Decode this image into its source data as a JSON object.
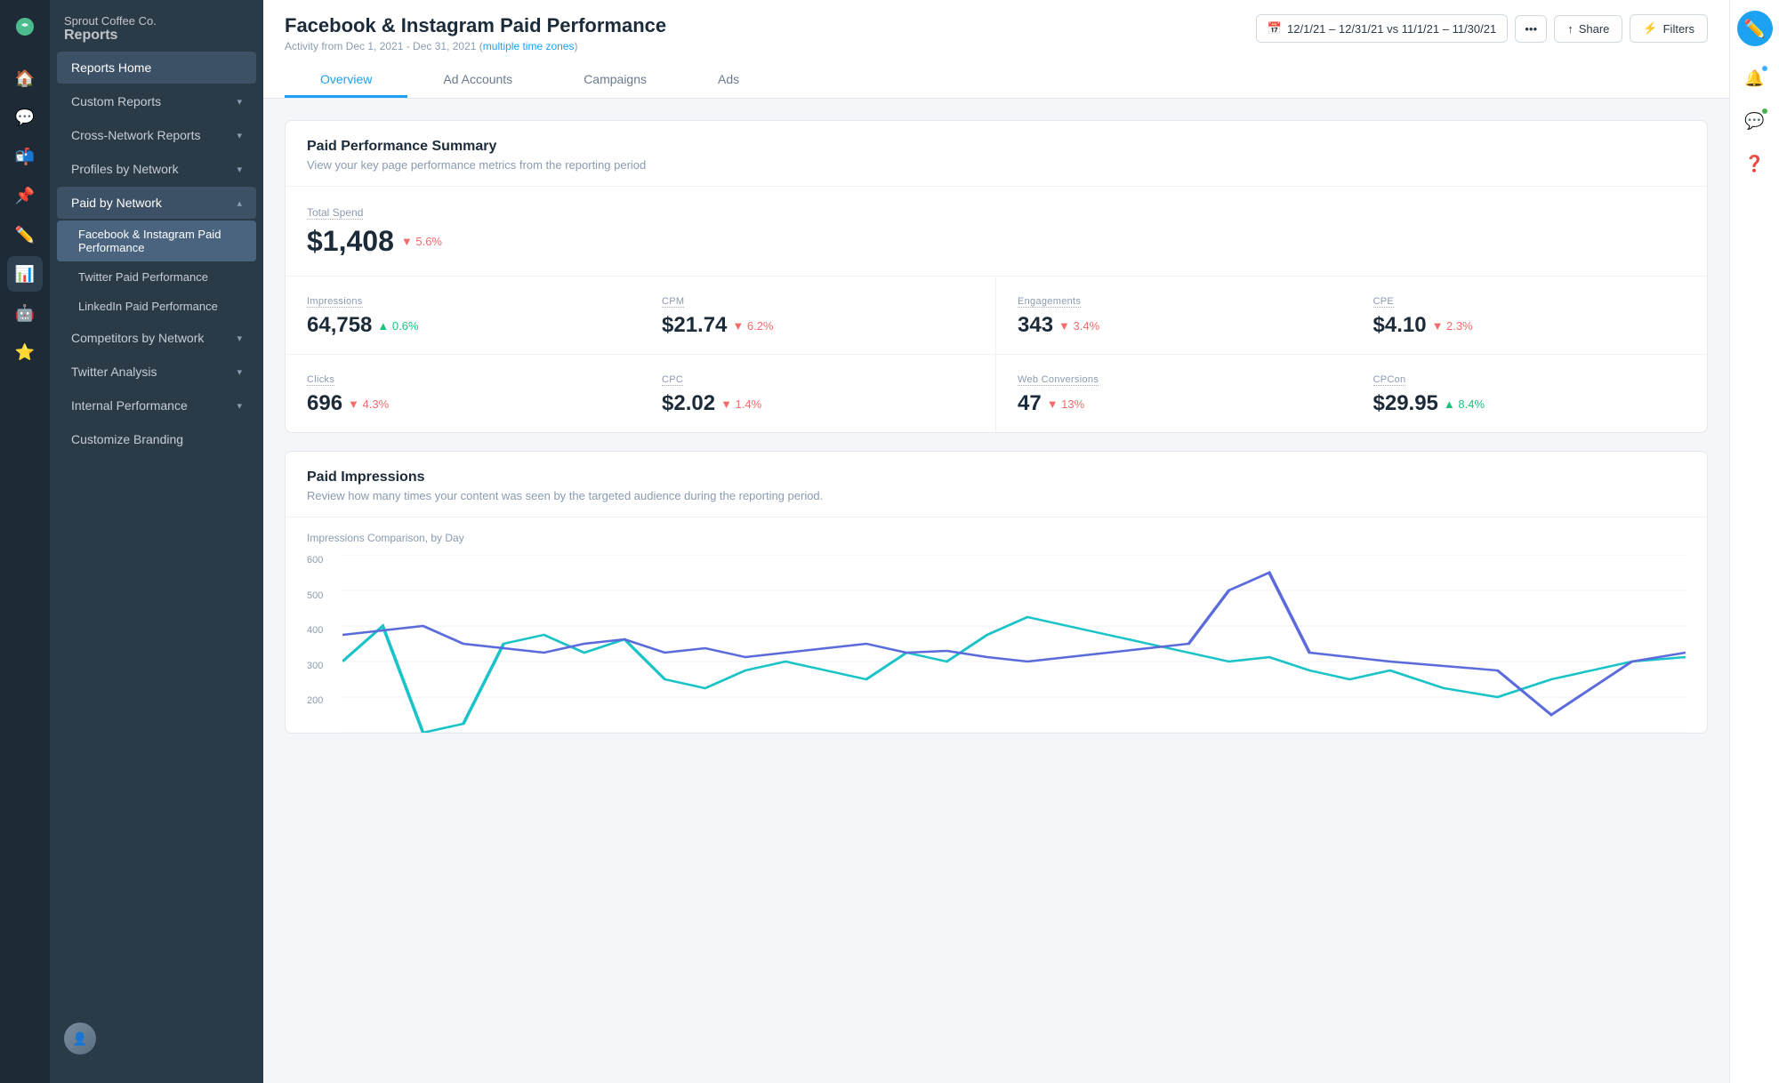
{
  "brand": {
    "company": "Sprout Coffee Co.",
    "app": "Reports"
  },
  "sidebar": {
    "items": [
      {
        "id": "reports-home",
        "label": "Reports Home",
        "active": true,
        "hasChevron": false
      },
      {
        "id": "custom-reports",
        "label": "Custom Reports",
        "active": false,
        "hasChevron": true
      },
      {
        "id": "cross-network",
        "label": "Cross-Network Reports",
        "active": false,
        "hasChevron": true
      },
      {
        "id": "profiles-by-network",
        "label": "Profiles by Network",
        "active": false,
        "hasChevron": true
      },
      {
        "id": "paid-by-network",
        "label": "Paid by Network",
        "active": false,
        "hasChevron": true
      }
    ],
    "sub_items": [
      {
        "id": "fb-ig-paid",
        "label": "Facebook & Instagram Paid Performance",
        "active": true
      },
      {
        "id": "twitter-paid",
        "label": "Twitter Paid Performance",
        "active": false
      },
      {
        "id": "linkedin-paid",
        "label": "LinkedIn Paid Performance",
        "active": false
      }
    ],
    "bottom_items": [
      {
        "id": "competitors",
        "label": "Competitors by Network",
        "hasChevron": true
      },
      {
        "id": "twitter-analysis",
        "label": "Twitter Analysis",
        "hasChevron": true
      },
      {
        "id": "internal-performance",
        "label": "Internal Performance",
        "hasChevron": true
      },
      {
        "id": "customize-branding",
        "label": "Customize Branding",
        "hasChevron": false
      }
    ]
  },
  "header": {
    "title": "Facebook & Instagram Paid Performance",
    "subtitle": "Activity from Dec 1, 2021 - Dec 31, 2021",
    "timezone_label": "multiple time zones",
    "date_range": "12/1/21 – 12/31/21",
    "compare_range": "vs 11/1/21 – 11/30/21",
    "share_label": "Share",
    "filters_label": "Filters"
  },
  "tabs": [
    {
      "id": "overview",
      "label": "Overview",
      "active": true
    },
    {
      "id": "ad-accounts",
      "label": "Ad Accounts",
      "active": false
    },
    {
      "id": "campaigns",
      "label": "Campaigns",
      "active": false
    },
    {
      "id": "ads",
      "label": "Ads",
      "active": false
    }
  ],
  "summary": {
    "title": "Paid Performance Summary",
    "subtitle": "View your key page performance metrics from the reporting period",
    "total_spend_label": "Total Spend",
    "total_spend_value": "$1,408",
    "total_spend_change": "▼ 5.6%",
    "total_spend_direction": "down",
    "metrics_left": [
      {
        "label": "Impressions",
        "value": "64,758",
        "change": "▲ 0.6%",
        "direction": "up"
      },
      {
        "label": "CPM",
        "value": "$21.74",
        "change": "▼ 6.2%",
        "direction": "down"
      },
      {
        "label": "Clicks",
        "value": "696",
        "change": "▼ 4.3%",
        "direction": "down"
      },
      {
        "label": "CPC",
        "value": "$2.02",
        "change": "▼ 1.4%",
        "direction": "down"
      }
    ],
    "metrics_right": [
      {
        "label": "Engagements",
        "value": "343",
        "change": "▼ 3.4%",
        "direction": "down"
      },
      {
        "label": "CPE",
        "value": "$4.10",
        "change": "▼ 2.3%",
        "direction": "down"
      },
      {
        "label": "Web Conversions",
        "value": "47",
        "change": "▼ 13%",
        "direction": "down"
      },
      {
        "label": "CPCon",
        "value": "$29.95",
        "change": "▲ 8.4%",
        "direction": "up"
      }
    ]
  },
  "impressions_chart": {
    "title": "Paid Impressions",
    "subtitle": "Review how many times your content was seen by the targeted audience during the reporting period.",
    "comparison_label": "Impressions Comparison, by Day",
    "y_labels": [
      "600",
      "500",
      "400",
      "300",
      "200"
    ],
    "colors": {
      "current": "#19c3c8",
      "previous": "#5b6bdb"
    }
  },
  "icons": {
    "calendar": "📅",
    "share": "↑",
    "filter": "⚡",
    "chevron_down": "▾",
    "chevron_up": "▴",
    "arrow_up": "▲",
    "arrow_down": "▼"
  }
}
